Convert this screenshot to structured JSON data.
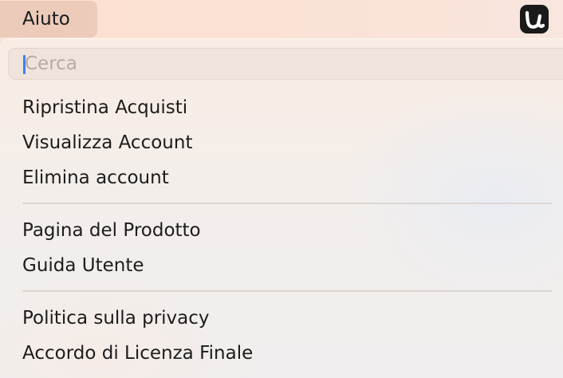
{
  "menubar": {
    "active_menu": "Aiuto",
    "app_icon": "app-u-logo-icon"
  },
  "search": {
    "placeholder": "Cerca",
    "value": ""
  },
  "menu_groups": [
    {
      "items": [
        "Ripristina Acquisti",
        "Visualizza Account",
        "Elimina account"
      ]
    },
    {
      "items": [
        "Pagina del Prodotto",
        "Guida Utente"
      ]
    },
    {
      "items": [
        "Politica sulla privacy",
        "Accordo di Licenza Finale"
      ]
    }
  ],
  "colors": {
    "caret": "#3b82f6",
    "icon_bg": "#1a1a1a"
  }
}
